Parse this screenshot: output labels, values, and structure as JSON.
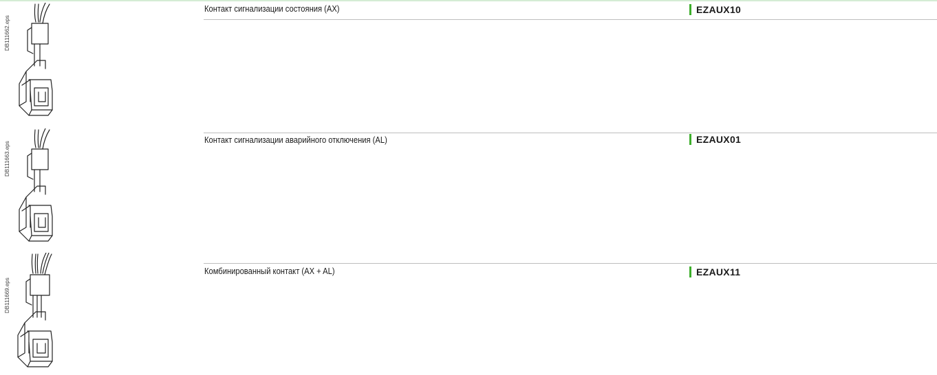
{
  "colors": {
    "accent": "#3dae2b",
    "rule": "#bdbdbd",
    "top_line": "#d4ecd4"
  },
  "items": [
    {
      "figure_id": "DB111662.eps",
      "description": "Контакт сигнализации состояния (AX)",
      "code": "EZAUX10",
      "icon": "auxiliary-contact-icon"
    },
    {
      "figure_id": "DB111663.eps",
      "description": "Контакт сигнализации аварийного отключения (AL)",
      "code": "EZAUX01",
      "icon": "auxiliary-contact-icon"
    },
    {
      "figure_id": "DB111669.eps",
      "description": "Комбинированный контакт (AX + AL)",
      "code": "EZAUX11",
      "icon": "combined-contact-icon"
    }
  ]
}
